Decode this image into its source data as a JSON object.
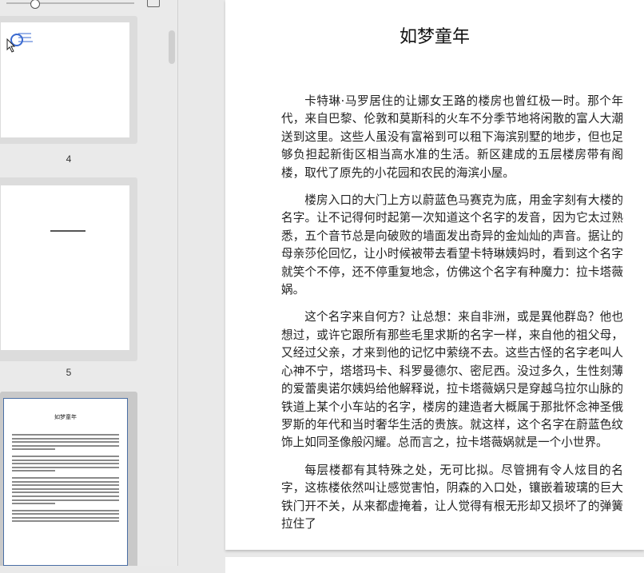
{
  "toolbar": {
    "zoom_level": 0.15,
    "icons": {
      "zoom_slider": "slider-knob",
      "image": "image-icon"
    }
  },
  "thumbnails": [
    {
      "page_number": "4",
      "selected": false,
      "content": "link-icon"
    },
    {
      "page_number": "5",
      "selected": false,
      "content": "短标题行"
    },
    {
      "page_number": "",
      "selected": true,
      "title": "如梦童年"
    }
  ],
  "document": {
    "title": "如梦童年",
    "paragraphs": [
      "卡特琳·马罗居住的让娜女王路的楼房也曾红极一时。那个年代，来自巴黎、伦敦和莫斯科的火车不分季节地将闲散的富人大潮送到这里。这些人虽没有富裕到可以租下海滨别墅的地步，但也足够负担起新街区相当高水准的生活。新区建成的五层楼房带有阁楼，取代了原先的小花园和农民的海滨小屋。",
      "楼房入口的大门上方以蔚蓝色马赛克为底，用金字刻有大楼的名字。让不记得何时起第一次知道这个名字的发音，因为它太过熟悉，五个音节总是向破败的墙面发出奇异的金灿灿的声音。据让的母亲莎伦回忆，让小时候被带去看望卡特琳姨妈时，看到这个名字就笑个不停，还不停重复地念，仿佛这个名字有种魔力：拉卡塔薇娲。",
      "这个名字来自何方？让总想：来自非洲，或是異他群岛？他也想过，或许它跟所有那些毛里求斯的名字一样，来自他的祖父母，又经过父亲，才来到他的记忆中萦绕不去。这些古怪的名字老叫人心神不宁，塔塔玛卡、科罗曼德尔、密尼西。没过多久，生性刻薄的爱蕾奥诺尔姨妈给他解释说，拉卡塔薇娲只是穿越乌拉尔山脉的铁道上某个小车站的名字，楼房的建造者大概属于那批怀念神圣俄罗斯的年代和当时奢华生活的贵族。就这样，这个名字在蔚蓝色纹饰上如同圣像般闪耀。总而言之，拉卡塔薇娲就是一个小世界。",
      "每层楼都有其特殊之处，无可比拟。尽管拥有令人炫目的名字，这栋楼依然叫让感觉害怕，阴森的入口处，镶嵌着玻璃的巨大铁门开不关，从来都虚掩着，让人觉得有根无形却又损坏了的弹簧拉住了"
    ]
  }
}
